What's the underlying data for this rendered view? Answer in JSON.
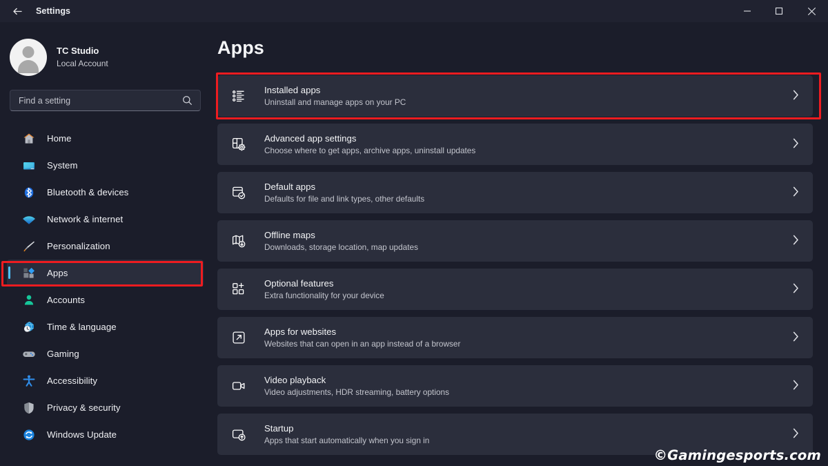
{
  "window": {
    "title": "Settings",
    "back_icon": "back-arrow-icon",
    "minimize_label": "Minimize",
    "maximize_label": "Maximize",
    "close_label": "Close"
  },
  "sidebar": {
    "profile": {
      "name": "TC Studio",
      "account_type": "Local Account",
      "avatar_icon": "user-avatar-icon"
    },
    "search": {
      "placeholder": "Find a setting",
      "value": "",
      "icon": "search-icon"
    },
    "items": [
      {
        "label": "Home",
        "icon": "home-icon",
        "selected": false
      },
      {
        "label": "System",
        "icon": "system-monitor-icon",
        "selected": false
      },
      {
        "label": "Bluetooth & devices",
        "icon": "bluetooth-icon",
        "selected": false
      },
      {
        "label": "Network & internet",
        "icon": "wifi-icon",
        "selected": false
      },
      {
        "label": "Personalization",
        "icon": "paintbrush-icon",
        "selected": false
      },
      {
        "label": "Apps",
        "icon": "apps-icon",
        "selected": true
      },
      {
        "label": "Accounts",
        "icon": "account-person-icon",
        "selected": false
      },
      {
        "label": "Time & language",
        "icon": "clock-globe-icon",
        "selected": false
      },
      {
        "label": "Gaming",
        "icon": "gamepad-icon",
        "selected": false
      },
      {
        "label": "Accessibility",
        "icon": "accessibility-icon",
        "selected": false
      },
      {
        "label": "Privacy & security",
        "icon": "shield-icon",
        "selected": false
      },
      {
        "label": "Windows Update",
        "icon": "update-refresh-icon",
        "selected": false
      }
    ]
  },
  "main": {
    "page_title": "Apps",
    "cards": [
      {
        "title": "Installed apps",
        "subtitle": "Uninstall and manage apps on your PC",
        "icon": "bullet-list-icon",
        "chevron": "chevron-right-icon",
        "highlighted": true
      },
      {
        "title": "Advanced app settings",
        "subtitle": "Choose where to get apps, archive apps, uninstall updates",
        "icon": "app-gear-icon",
        "chevron": "chevron-right-icon",
        "highlighted": false
      },
      {
        "title": "Default apps",
        "subtitle": "Defaults for file and link types, other defaults",
        "icon": "app-check-icon",
        "chevron": "chevron-right-icon",
        "highlighted": false
      },
      {
        "title": "Offline maps",
        "subtitle": "Downloads, storage location, map updates",
        "icon": "map-download-icon",
        "chevron": "chevron-right-icon",
        "highlighted": false
      },
      {
        "title": "Optional features",
        "subtitle": "Extra functionality for your device",
        "icon": "grid-plus-icon",
        "chevron": "chevron-right-icon",
        "highlighted": false
      },
      {
        "title": "Apps for websites",
        "subtitle": "Websites that can open in an app instead of a browser",
        "icon": "external-link-icon",
        "chevron": "chevron-right-icon",
        "highlighted": false
      },
      {
        "title": "Video playback",
        "subtitle": "Video adjustments, HDR streaming, battery options",
        "icon": "video-camera-icon",
        "chevron": "chevron-right-icon",
        "highlighted": false
      },
      {
        "title": "Startup",
        "subtitle": "Apps that start automatically when you sign in",
        "icon": "startup-arrow-icon",
        "chevron": "chevron-right-icon",
        "highlighted": false
      }
    ]
  },
  "annotations": {
    "highlight_color": "#ee1c20",
    "accent_color": "#4cc2ff",
    "watermark": "©Gamingesports.com"
  }
}
